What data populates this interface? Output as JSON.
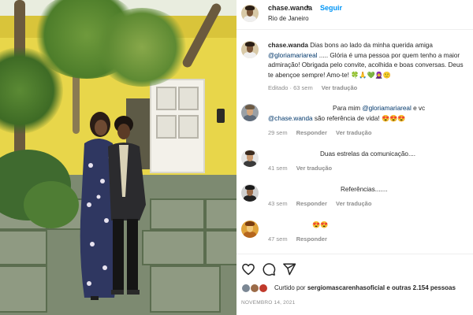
{
  "header": {
    "username": "chase.wanda",
    "separator": "•",
    "follow_label": "Seguir",
    "location": "Rio de Janeiro"
  },
  "caption": {
    "username": "chase.wanda",
    "text_1": "Dias bons ao lado da minha querida amiga",
    "mention": "@gloriamariareal",
    "text_2": "..... Glória é uma pessoa por quem tenho a maior admiração! Obrigada pelo convite, acolhida e boas conversas. Deus te abençoe sempre! Amo-te!",
    "emojis": "🍀🙏💚🧕🙂",
    "meta": {
      "edited": "Editado · 63 sem",
      "translate": "Ver tradução"
    }
  },
  "comments": [
    {
      "text_1": "Para mim",
      "mention_1": "@gloriamariareal",
      "text_2": "e vc",
      "mention_2": "@chase.wanda",
      "text_3": "são referência de vida!",
      "emojis": "😍😍😍",
      "time": "29 sem",
      "reply": "Responder",
      "translate": "Ver tradução"
    },
    {
      "text": "Duas estrelas da comunicação....",
      "time": "41 sem",
      "translate": "Ver tradução"
    },
    {
      "text": "Referências.......",
      "time": "43 sem",
      "reply": "Responder",
      "translate": "Ver tradução"
    },
    {
      "emojis": "😍😍",
      "time": "47 sem",
      "reply": "Responder"
    }
  ],
  "actions": {
    "icons": [
      "heart-icon",
      "comment-icon",
      "share-icon"
    ]
  },
  "likes": {
    "prefix": "Curtido por",
    "user": "sergiomascarenhasoficial",
    "suffix": "e outras 2.154 pessoas"
  },
  "date": "NOVEMBRO 14, 2021",
  "colors": {
    "link": "#00376b",
    "follow": "#0095f6",
    "muted": "#8e8e8e"
  }
}
